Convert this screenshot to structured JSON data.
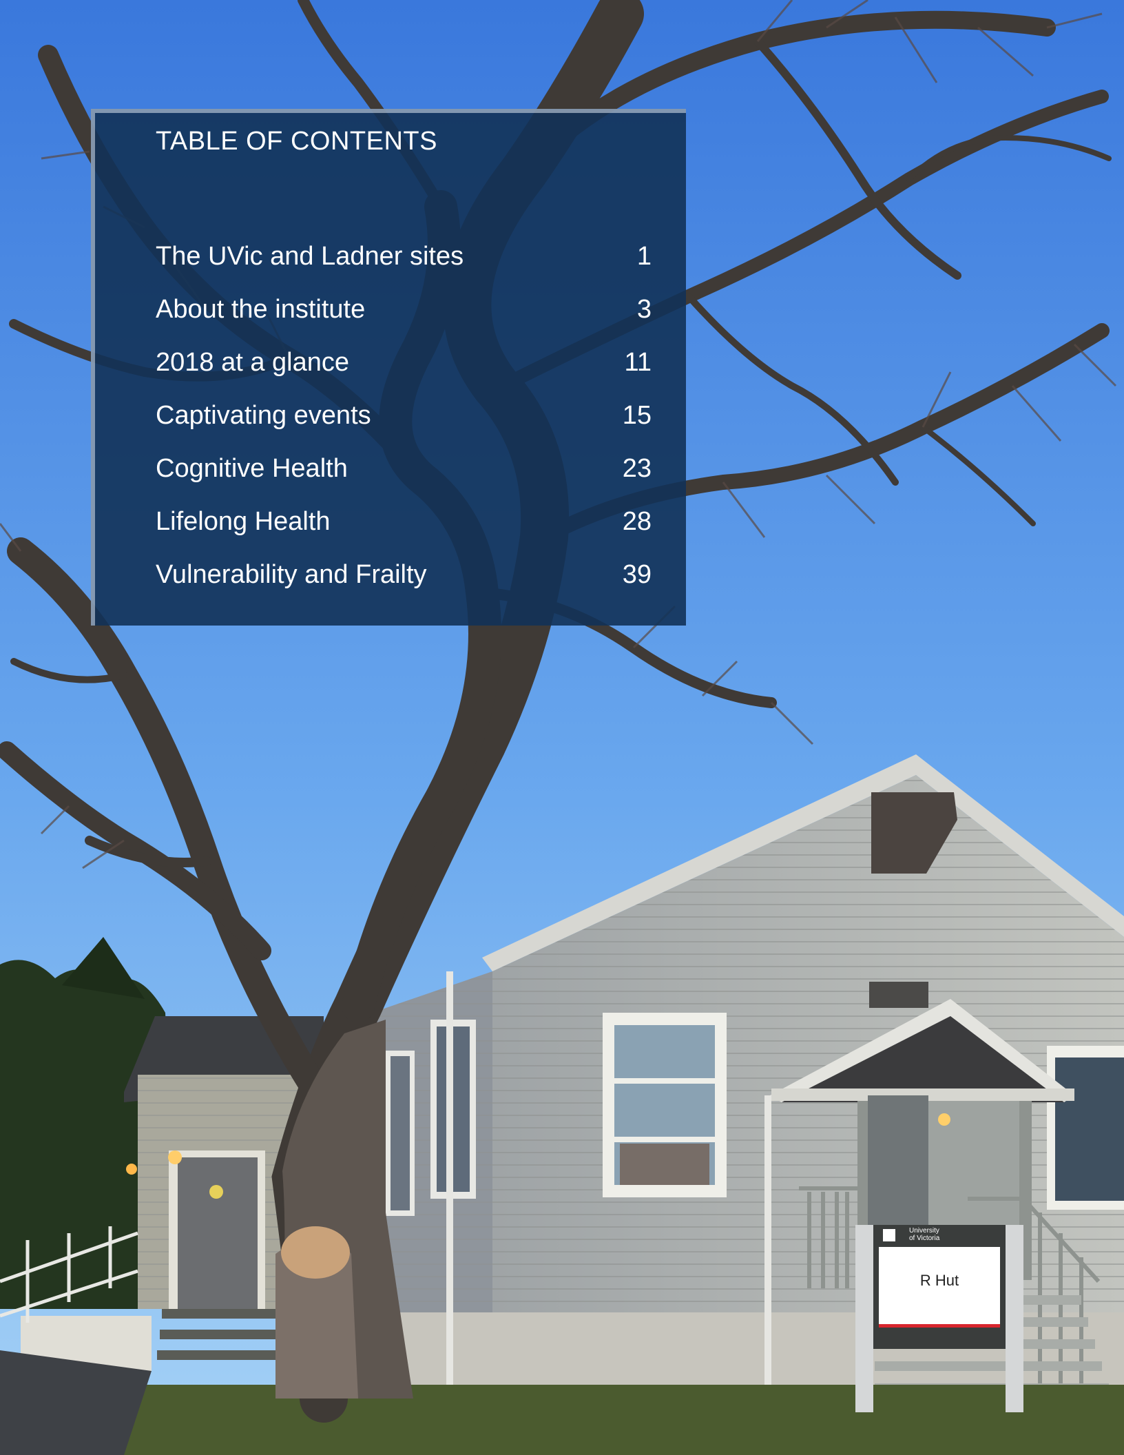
{
  "toc": {
    "title": "TABLE OF CONTENTS",
    "entries": [
      {
        "label": "The UVic and Ladner sites",
        "page": "1"
      },
      {
        "label": "About the institute",
        "page": "3"
      },
      {
        "label": "2018 at a glance",
        "page": "11"
      },
      {
        "label": "Captivating events",
        "page": "15"
      },
      {
        "label": "Cognitive Health",
        "page": "23"
      },
      {
        "label": "Lifelong Health",
        "page": "28"
      },
      {
        "label": "Vulnerability and Frailty",
        "page": "39"
      }
    ]
  },
  "sign": {
    "logo_line1": "University",
    "logo_line2": "of Victoria",
    "name": "R Hut"
  },
  "colors": {
    "panel": "#123258",
    "sky_top": "#3f7fe0",
    "sky_bottom": "#8cc4f4",
    "siding": "#b9bcb8",
    "grass": "#4a5a2e"
  }
}
